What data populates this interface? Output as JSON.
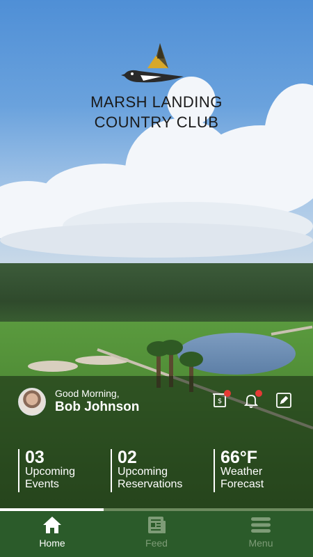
{
  "club": {
    "name_line1": "MARSH LANDING",
    "name_line2": "COUNTRY CLUB"
  },
  "user": {
    "greeting": "Good Morning,",
    "name": "Bob Johnson"
  },
  "actions": [
    {
      "icon": "statement-dollar-icon",
      "has_badge": true
    },
    {
      "icon": "bell-icon",
      "has_badge": true
    },
    {
      "icon": "edit-icon",
      "has_badge": false
    }
  ],
  "stats": [
    {
      "value": "03",
      "label_line1": "Upcoming",
      "label_line2": "Events"
    },
    {
      "value": "02",
      "label_line1": "Upcoming",
      "label_line2": "Reservations"
    },
    {
      "value": "66°F",
      "label_line1": "Weather",
      "label_line2": "Forecast"
    }
  ],
  "carousel": {
    "progress": 0.33
  },
  "tabs": [
    {
      "label": "Home",
      "icon": "home-icon",
      "active": true
    },
    {
      "label": "Feed",
      "icon": "newspaper-icon",
      "active": false
    },
    {
      "label": "Menu",
      "icon": "menu-icon",
      "active": false
    }
  ],
  "colors": {
    "tabbar": "#2b5b2a",
    "badge": "#e53935",
    "inactive": "#7e9c77"
  }
}
